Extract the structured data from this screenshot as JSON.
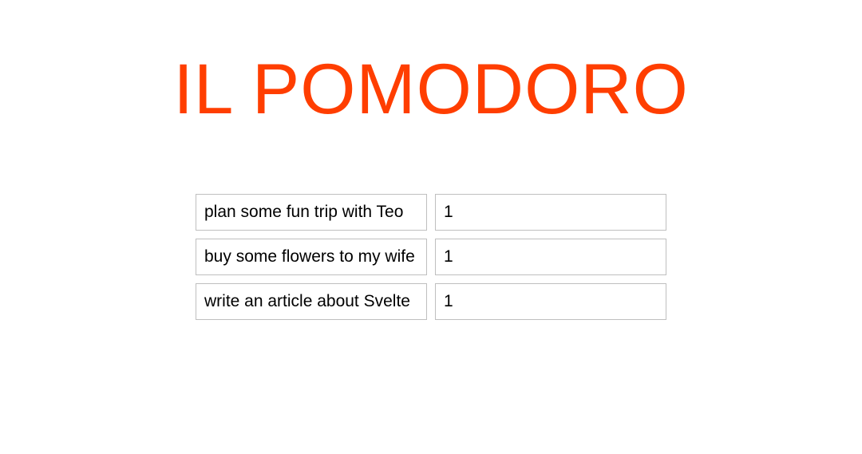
{
  "title": "IL POMODORO",
  "tasks": [
    {
      "name": "plan some fun trip with Teo",
      "count": "1"
    },
    {
      "name": "buy some flowers to my wife",
      "count": "1"
    },
    {
      "name": "write an article about Svelte",
      "count": "1"
    }
  ]
}
